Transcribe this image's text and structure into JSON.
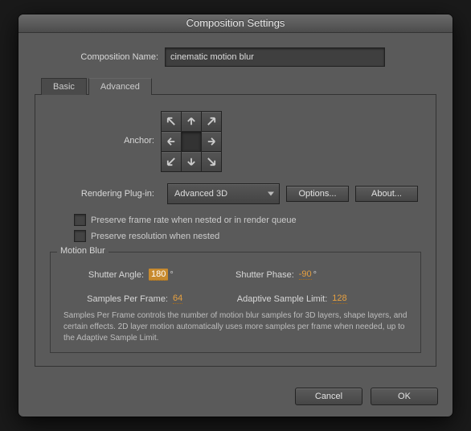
{
  "window": {
    "title": "Composition Settings"
  },
  "comp_name": {
    "label": "Composition Name:",
    "value": "cinematic motion blur"
  },
  "tabs": {
    "basic": "Basic",
    "advanced": "Advanced",
    "active": "advanced"
  },
  "anchor": {
    "label": "Anchor:"
  },
  "rendering": {
    "label": "Rendering Plug-in:",
    "value": "Advanced 3D",
    "options_btn": "Options...",
    "about_btn": "About..."
  },
  "checks": {
    "preserve_rate": "Preserve frame rate when nested or in render queue",
    "preserve_res": "Preserve resolution when nested"
  },
  "motion_blur": {
    "legend": "Motion Blur",
    "shutter_angle_label": "Shutter Angle:",
    "shutter_angle_value": "180",
    "degree": "°",
    "shutter_phase_label": "Shutter Phase:",
    "shutter_phase_value": "-90",
    "samples_label": "Samples Per Frame:",
    "samples_value": "64",
    "adaptive_label": "Adaptive Sample Limit:",
    "adaptive_value": "128",
    "desc": "Samples Per Frame controls the number of motion blur samples for 3D layers, shape layers, and certain effects. 2D layer motion automatically uses more samples per frame when needed, up to the Adaptive Sample Limit."
  },
  "footer": {
    "cancel": "Cancel",
    "ok": "OK"
  }
}
